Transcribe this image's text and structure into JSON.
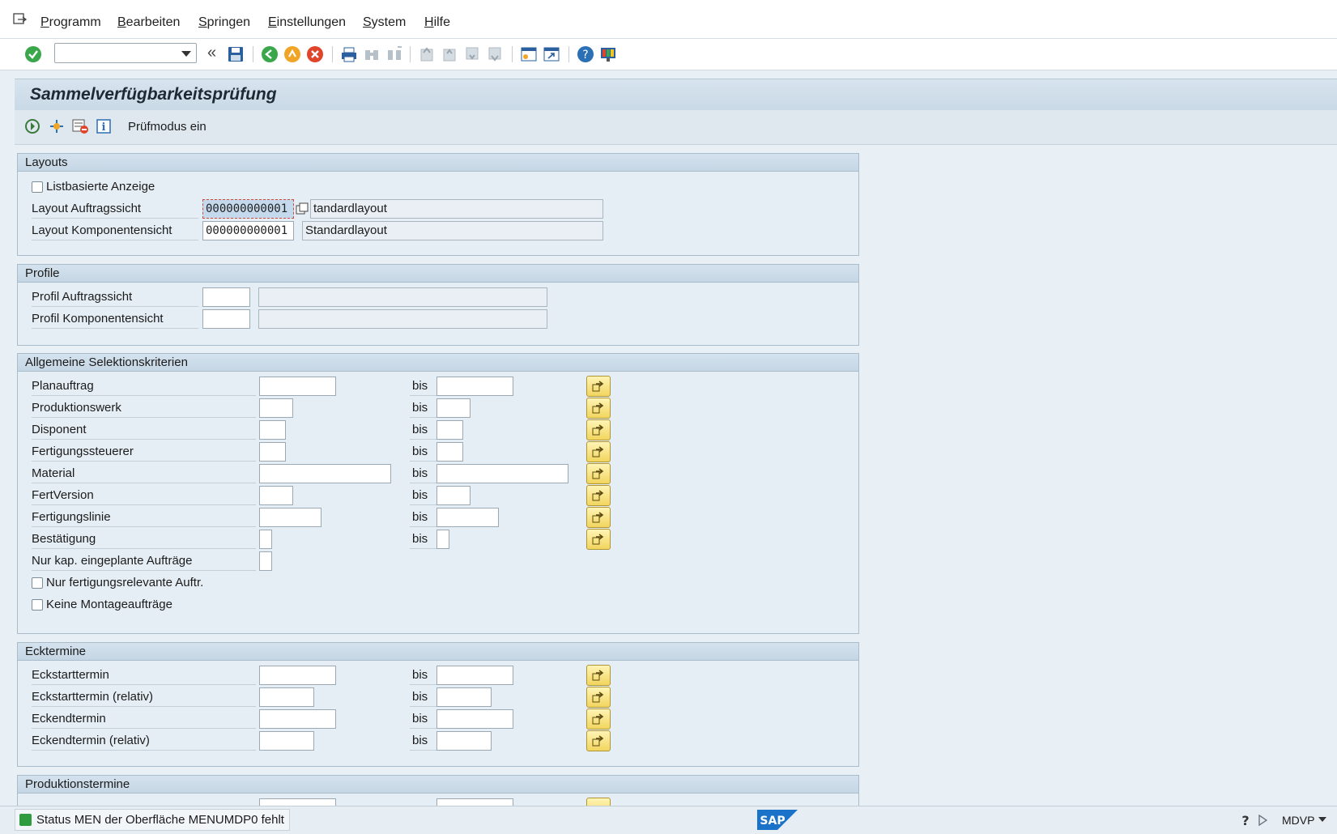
{
  "menu": [
    "Programm",
    "Bearbeiten",
    "Springen",
    "Einstellungen",
    "System",
    "Hilfe"
  ],
  "toolbar": {
    "command_field_value": "",
    "back_chevrons": "«"
  },
  "screen": {
    "title": "Sammelverfügbarkeitsprüfung",
    "app_toolbar_label": "Prüfmodus ein"
  },
  "sections": {
    "layouts": {
      "header": "Layouts",
      "checkbox_list": "Listbasierte Anzeige",
      "row1_label": "Layout Auftragssicht",
      "row1_value": "000000000001",
      "row1_desc": "tandardlayout",
      "row2_label": "Layout Komponentensicht",
      "row2_value": "000000000001",
      "row2_desc": "Standardlayout"
    },
    "profile": {
      "header": "Profile",
      "row1_label": "Profil Auftragssicht",
      "row2_label": "Profil Komponentensicht"
    },
    "selection": {
      "header": "Allgemeine Selektionskriterien",
      "bis": "bis",
      "rows": [
        "Planauftrag",
        "Produktionswerk",
        "Disponent",
        "Fertigungssteuerer",
        "Material",
        "FertVersion",
        "Fertigungslinie",
        "Bestätigung"
      ],
      "nur_kap": "Nur kap. eingeplante Aufträge",
      "chk1": "Nur fertigungsrelevante Auftr.",
      "chk2": "Keine Montageaufträge"
    },
    "ecktermine": {
      "header": "Ecktermine",
      "rows": [
        "Eckstarttermin",
        "Eckstarttermin (relativ)",
        "Eckendtermin",
        "Eckendtermin (relativ)"
      ]
    },
    "produktionstermine": {
      "header": "Produktionstermine"
    }
  },
  "status": {
    "message": "Status MEN der Oberfläche MENUMDP0 fehlt",
    "system": "MDVP"
  },
  "colors": {
    "accent": "#c9d9e6",
    "multi_select_button": "#f2d55e",
    "ok_green": "#2e9b3f"
  }
}
